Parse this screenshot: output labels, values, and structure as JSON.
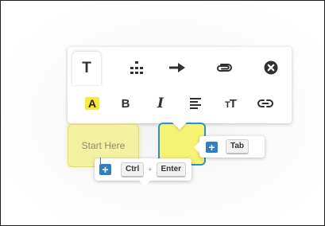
{
  "toolbar": {
    "top_row": [
      {
        "name": "text-tool",
        "icon": "text-T-icon",
        "glyph": "T",
        "active": true
      },
      {
        "name": "hierarchy-tool",
        "icon": "hierarchy-icon"
      },
      {
        "name": "arrow-tool",
        "icon": "arrow-right-icon"
      },
      {
        "name": "attach-tool",
        "icon": "paperclip-icon"
      },
      {
        "name": "delete-tool",
        "icon": "close-circle-icon"
      }
    ],
    "bottom_row": [
      {
        "name": "highlight",
        "glyph": "A",
        "icon": "highlight-icon",
        "highlight_color": "#f7e93a"
      },
      {
        "name": "bold",
        "glyph": "B",
        "icon": "bold-icon"
      },
      {
        "name": "italic",
        "glyph": "I",
        "icon": "italic-icon"
      },
      {
        "name": "align",
        "icon": "align-left-icon"
      },
      {
        "name": "text-size",
        "glyph": "TT",
        "icon": "text-size-icon"
      },
      {
        "name": "link",
        "icon": "link-icon"
      }
    ]
  },
  "notes": {
    "note1_text": "Start Here",
    "note1_color": "#f3f1a2",
    "note2_color": "#f6f273",
    "selection_color": "#2b8fd6"
  },
  "hints": {
    "right": {
      "icon": "plus-icon",
      "key": "Tab"
    },
    "down": {
      "icon": "plus-icon",
      "keys": [
        "Ctrl",
        "Enter"
      ],
      "separator": "+"
    }
  },
  "accent_color": "#2f7fc1"
}
